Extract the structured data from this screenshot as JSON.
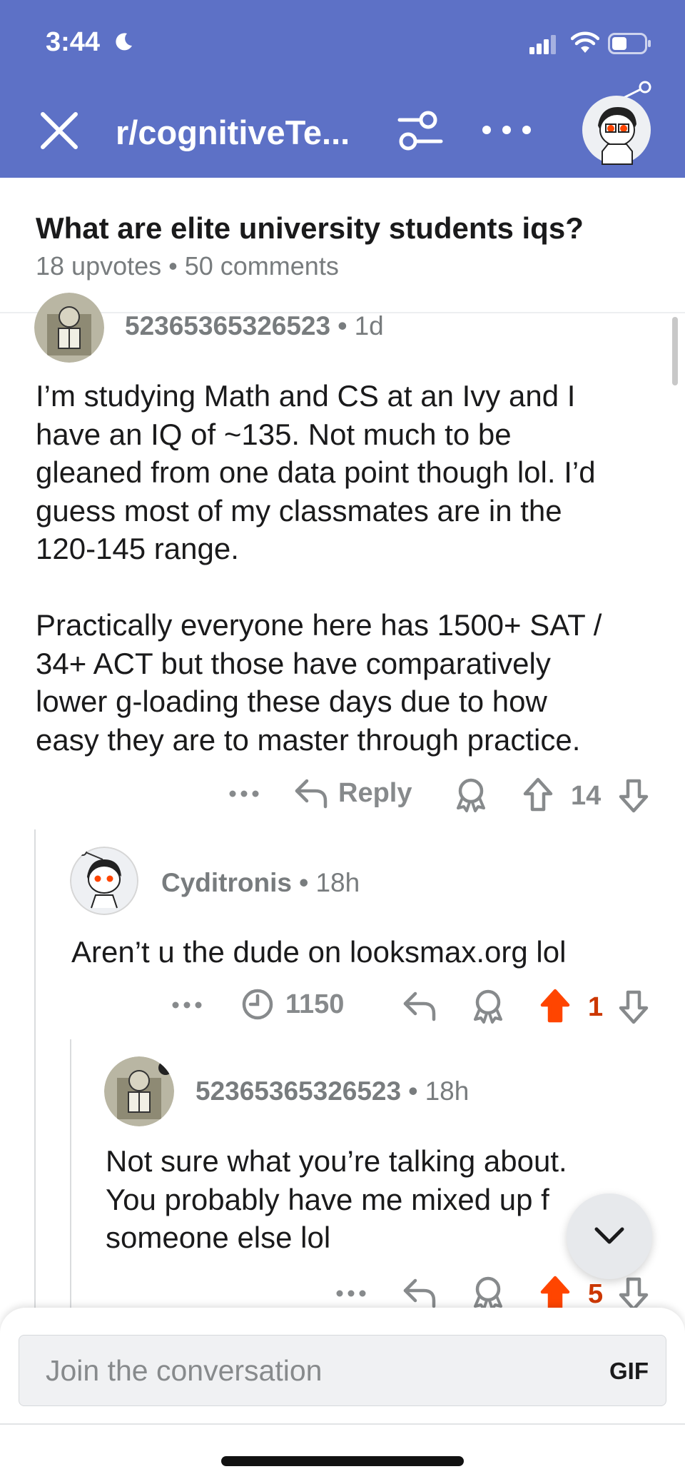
{
  "status_bar": {
    "time": "3:44"
  },
  "header": {
    "subreddit": "r/cognitiveTe...",
    "colors": {
      "background": "#5d71c6",
      "text": "#ffffff"
    }
  },
  "post": {
    "title": "What are elite university students iqs?",
    "meta": "18 upvotes • 50 comments"
  },
  "comments": [
    {
      "username": "52365365326523",
      "time": "1d",
      "body_lines": [
        "I’m studying Math and CS at an Ivy and I",
        "have an IQ of ~135. Not much to be",
        "gleaned from one data point though lol. I’d",
        "guess most of my classmates are in the",
        "120-145 range.",
        "",
        "Practically everyone here has 1500+ SAT /",
        "34+ ACT but those have comparatively",
        "lower g-loading these days due to how",
        "easy they are to master through practice."
      ],
      "reply_label": "Reply",
      "votes": "14",
      "upvoted": false
    },
    {
      "username": "Cyditronis",
      "time": "18h",
      "body_lines": [
        "Aren’t u the dude on looksmax.org lol"
      ],
      "timer_count": "1150",
      "votes": "1",
      "upvoted": true
    },
    {
      "username": "52365365326523",
      "time": "18h",
      "body_lines": [
        "Not sure what  you’re talking about.",
        "You probably have me mixed up f",
        "someone else lol"
      ],
      "votes": "5",
      "upvoted": true
    }
  ],
  "composer": {
    "placeholder": "Join the conversation",
    "gif_label": "GIF"
  },
  "icons": {
    "close": "close-icon",
    "filter": "filter-icon",
    "more": "more-icon",
    "reply": "reply-icon",
    "award": "award-icon",
    "upvote": "upvote-icon",
    "downvote": "downvote-icon",
    "timer": "timer-icon",
    "scroll_down": "chevron-down-icon"
  },
  "colors": {
    "upvote_active": "#ff4500",
    "upvote_count_active": "#cc3700",
    "muted": "#878a8c"
  }
}
